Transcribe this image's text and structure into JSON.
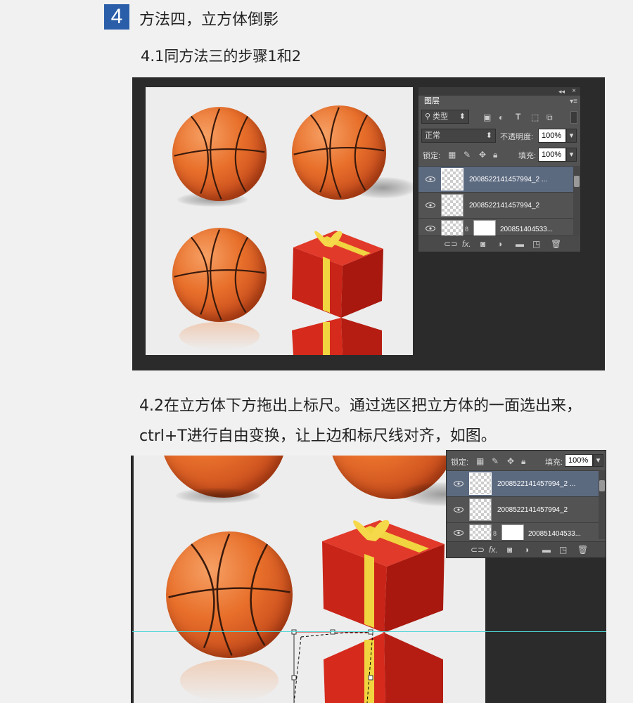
{
  "step": {
    "number": "4",
    "title": "方法四，立方体倒影"
  },
  "sub_step": "4.1同方法三的步骤1和2",
  "paragraph": "4.2在立方体下方拖出上标尺。通过选区把立方体的一面选出来，ctrl+T进行自由变换，让上边和标尺线对齐，如图。",
  "layers_panel": {
    "tab_label": "图层",
    "filter_label": "类型",
    "blend_mode": "正常",
    "opacity_label": "不透明度:",
    "opacity_value": "100%",
    "lock_label": "锁定:",
    "fill_label": "填充:",
    "fill_value": "100%",
    "layers": [
      {
        "name": "2008522141457994_2 ...",
        "selected": true
      },
      {
        "name": "2008522141457994_2",
        "selected": false
      },
      {
        "name": "200851404533...",
        "selected": false
      }
    ]
  },
  "layers_panel_2": {
    "lock_label": "锁定:",
    "fill_label": "填充:",
    "fill_value": "100%",
    "layers": [
      {
        "name": "2008522141457994_2 ...",
        "selected": true
      },
      {
        "name": "2008522141457994_2",
        "selected": false
      },
      {
        "name": "200851404533...",
        "selected": false
      }
    ]
  },
  "colors": {
    "step_badge": "#2a5ea8",
    "ruler_guide": "#4fd6d6",
    "panel_bg": "#535353",
    "selected_layer": "#5c6a80"
  }
}
